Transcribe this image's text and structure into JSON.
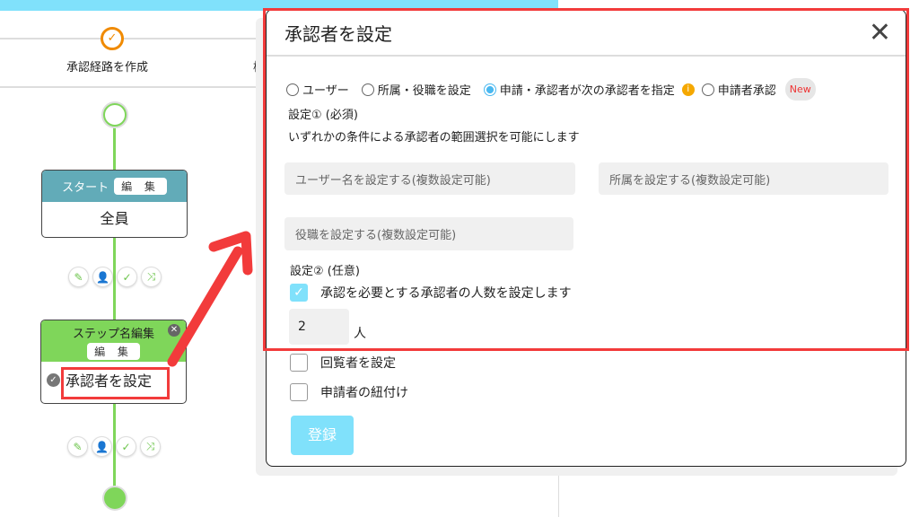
{
  "steps": {
    "current_label": "承認経路を作成",
    "next_label_partial": "権"
  },
  "flow": {
    "start_node": {
      "header": "スタート",
      "edit": "編 集",
      "body": "全員"
    },
    "step_node": {
      "header": "ステップ名編集",
      "edit": "編 集",
      "body": "承認者を設定"
    },
    "action_icons": [
      "pencil-icon",
      "add-user-icon",
      "check-icon",
      "shuffle-icon"
    ]
  },
  "modal": {
    "title": "承認者を設定",
    "radios": [
      {
        "label": "ユーザー",
        "selected": false
      },
      {
        "label": "所属・役職を設定",
        "selected": false
      },
      {
        "label": "申請・承認者が次の承認者を指定",
        "selected": true
      },
      {
        "label": "申請者承認",
        "selected": false
      }
    ],
    "new_badge": "New",
    "setting1_title": "設定① (必須)",
    "setting1_desc": "いずれかの条件による承認者の範囲選択を可能にします",
    "user_placeholder": "ユーザー名を設定する(複数設定可能)",
    "dept_placeholder": "所属を設定する(複数設定可能)",
    "role_placeholder": "役職を設定する(複数設定可能)",
    "setting2_title": "設定② (任意)",
    "require_count_label": "承認を必要とする承認者の人数を設定します",
    "require_count_checked": true,
    "count_value": "2",
    "count_unit": "人",
    "viewer_label": "回覧者を設定",
    "viewer_checked": false,
    "link_applicant_label": "申請者の紐付け",
    "link_applicant_checked": false,
    "submit": "登録"
  },
  "colors": {
    "accent": "#80e1fb",
    "green": "#7fd65a",
    "teal": "#62abb8",
    "annotation_red": "#f23b3b",
    "orange": "#f08a00"
  }
}
